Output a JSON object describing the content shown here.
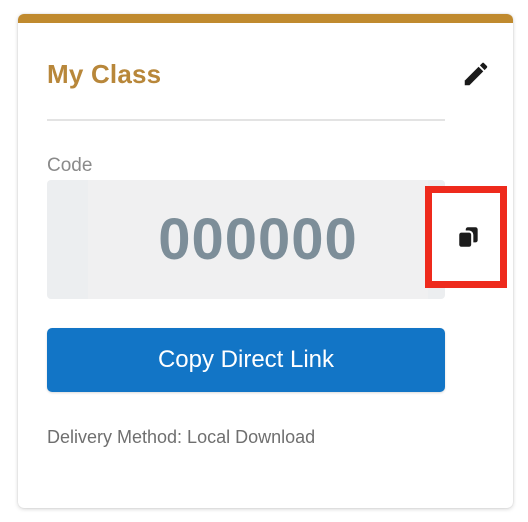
{
  "card": {
    "title": "My Class",
    "accent_color": "#c08a2e",
    "edit_icon": "pencil-icon"
  },
  "code": {
    "label": "Code",
    "value": "000000",
    "copy_icon": "copy-icon"
  },
  "actions": {
    "copy_link_label": "Copy Direct Link",
    "button_color": "#1275c6"
  },
  "delivery": {
    "text": "Delivery Method: Local Download"
  },
  "highlight_color": "#ee2a1c"
}
